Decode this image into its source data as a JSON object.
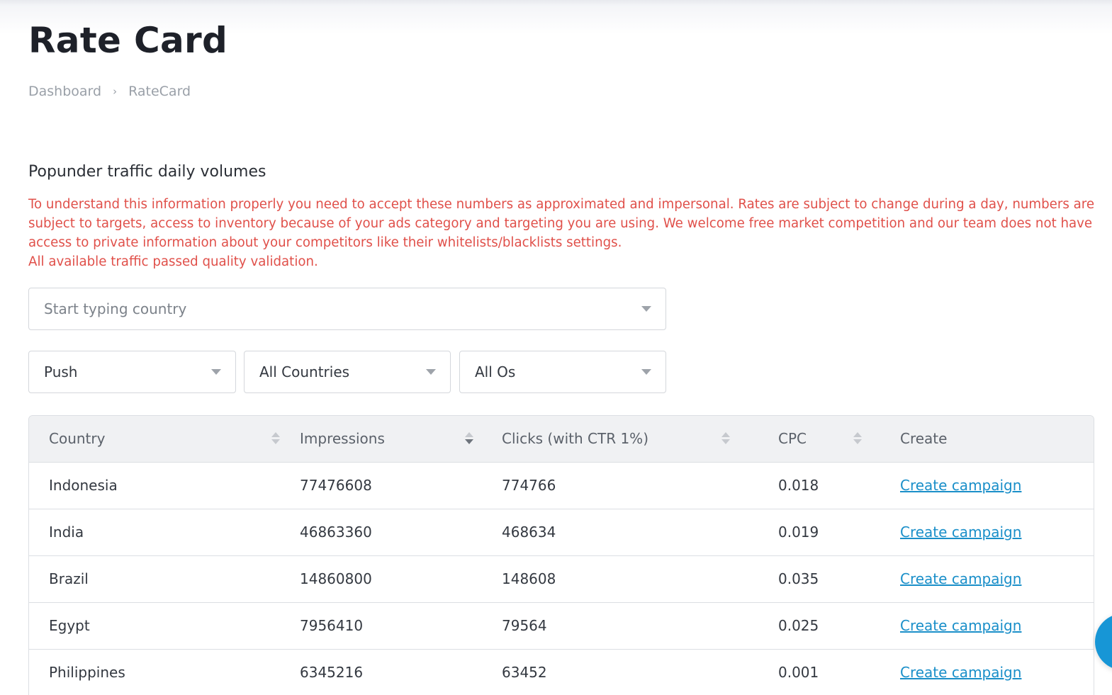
{
  "page": {
    "title": "Rate Card"
  },
  "breadcrumb": {
    "items": [
      "Dashboard",
      "RateCard"
    ],
    "separator": "›"
  },
  "section": {
    "title": "Popunder traffic daily volumes",
    "notice_lines": [
      "To understand this information properly you need to accept these numbers as approximated and impersonal. Rates are subject to change during a day, numbers are subject to targets, access to inventory because of your ads category and targeting you are using. We welcome free market competition and our team does not have access to private information about your competitors like their whitelists/blacklists settings.",
      "All available traffic passed quality validation."
    ],
    "notice_color": "#e0504a"
  },
  "filters": {
    "country_search": {
      "placeholder": "Start typing country",
      "value": ""
    },
    "traffic_type": {
      "selected": "Push"
    },
    "countries": {
      "selected": "All Countries"
    },
    "os": {
      "selected": "All Os"
    }
  },
  "table": {
    "columns": [
      {
        "label": "Country",
        "sortable": true,
        "sorted": false
      },
      {
        "label": "Impressions",
        "sortable": true,
        "sorted": true
      },
      {
        "label": "Clicks (with CTR 1%)",
        "sortable": true,
        "sorted": false
      },
      {
        "label": "CPC",
        "sortable": true,
        "sorted": false
      },
      {
        "label": "Create",
        "sortable": false,
        "sorted": false
      }
    ],
    "rows": [
      {
        "country": "Indonesia",
        "impressions": "77476608",
        "clicks": "774766",
        "cpc": "0.018",
        "create": "Create campaign"
      },
      {
        "country": "India",
        "impressions": "46863360",
        "clicks": "468634",
        "cpc": "0.019",
        "create": "Create campaign"
      },
      {
        "country": "Brazil",
        "impressions": "14860800",
        "clicks": "148608",
        "cpc": "0.035",
        "create": "Create campaign"
      },
      {
        "country": "Egypt",
        "impressions": "7956410",
        "clicks": "79564",
        "cpc": "0.025",
        "create": "Create campaign"
      },
      {
        "country": "Philippines",
        "impressions": "6345216",
        "clicks": "63452",
        "cpc": "0.001",
        "create": "Create campaign"
      }
    ]
  },
  "colors": {
    "link": "#1a8fc9",
    "chat_bubble": "#1796d6"
  }
}
